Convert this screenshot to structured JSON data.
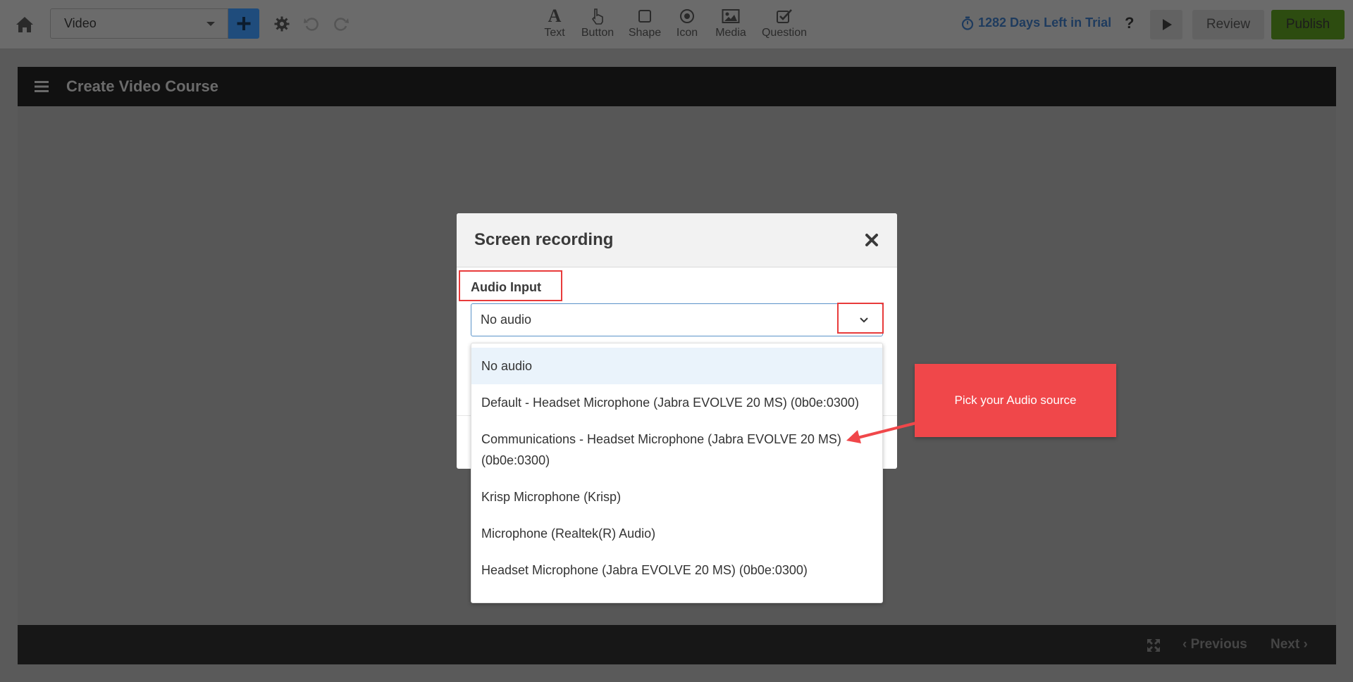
{
  "toolbar": {
    "slide_type": "Video",
    "tools": [
      {
        "label": "Text",
        "icon": "text-icon"
      },
      {
        "label": "Button",
        "icon": "pointer-icon"
      },
      {
        "label": "Shape",
        "icon": "square-icon"
      },
      {
        "label": "Icon",
        "icon": "target-icon"
      },
      {
        "label": "Media",
        "icon": "image-icon"
      },
      {
        "label": "Question",
        "icon": "checkbox-icon"
      }
    ],
    "trial_text": "1282 Days Left in Trial",
    "help_label": "?",
    "review_label": "Review",
    "publish_label": "Publish"
  },
  "canvas": {
    "title": "Create Video Course",
    "prev_label": "Previous",
    "next_label": "Next"
  },
  "modal": {
    "title": "Screen recording",
    "audio_label": "Audio Input",
    "audio_selected": "No audio",
    "options": [
      "No audio",
      "Default - Headset Microphone (Jabra EVOLVE 20 MS) (0b0e:0300)",
      "Communications - Headset Microphone (Jabra EVOLVE 20 MS) (0b0e:0300)",
      "Krisp Microphone (Krisp)",
      "Microphone (Realtek(R) Audio)",
      "Headset Microphone (Jabra EVOLVE 20 MS) (0b0e:0300)"
    ]
  },
  "callout": {
    "text": "Pick your Audio source"
  },
  "colors": {
    "accent_blue": "#1f4c7c",
    "publish_green": "#2d4c10",
    "highlight_red": "#e83b3b",
    "callout_red": "#f0474a"
  }
}
